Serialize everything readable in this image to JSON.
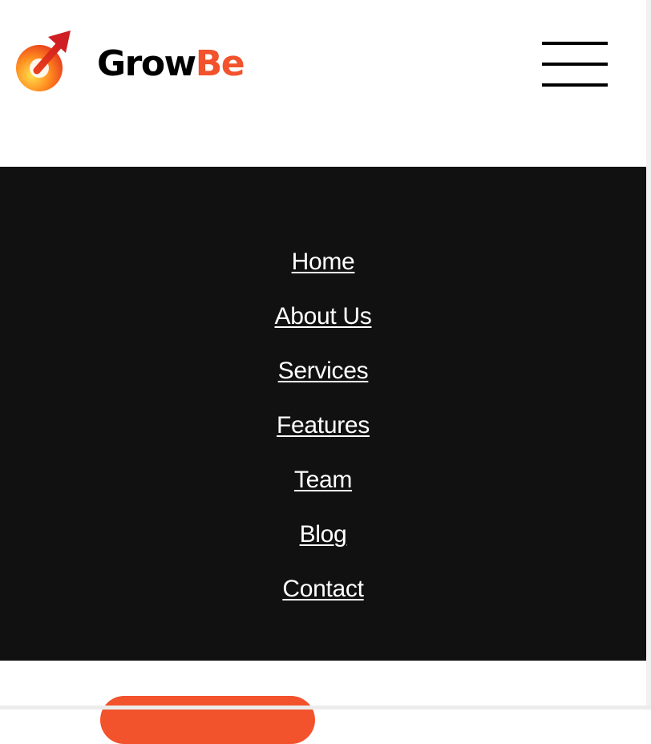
{
  "header": {
    "brand_part_1": "Grow",
    "brand_part_2": "Be",
    "logo_icon": "growbe-arrow-logo-icon",
    "menu_icon": "hamburger-menu-icon"
  },
  "nav": {
    "items": [
      {
        "label": "Home"
      },
      {
        "label": "About Us"
      },
      {
        "label": "Services"
      },
      {
        "label": "Features"
      },
      {
        "label": "Team"
      },
      {
        "label": "Blog"
      },
      {
        "label": "Contact"
      }
    ]
  },
  "colors": {
    "accent": "#f2522c",
    "nav_background": "#111111",
    "header_background": "#ffffff",
    "text_dark": "#000000",
    "text_light": "#ffffff"
  }
}
